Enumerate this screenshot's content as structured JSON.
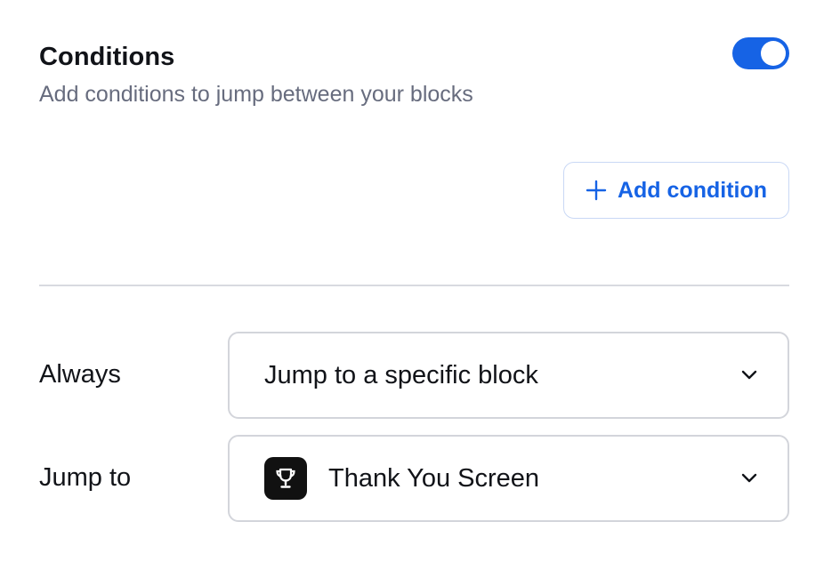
{
  "header": {
    "title": "Conditions",
    "subtitle": "Add conditions to jump between your blocks",
    "toggle_enabled": true
  },
  "actions": {
    "add_condition_label": "Add condition"
  },
  "rules": [
    {
      "label": "Always",
      "value": "Jump to a specific block"
    },
    {
      "label": "Jump to",
      "value": "Thank You Screen",
      "icon": "trophy-icon"
    }
  ],
  "colors": {
    "accent": "#1663e5",
    "muted_text": "#676c7e",
    "border": "#d3d5db"
  }
}
